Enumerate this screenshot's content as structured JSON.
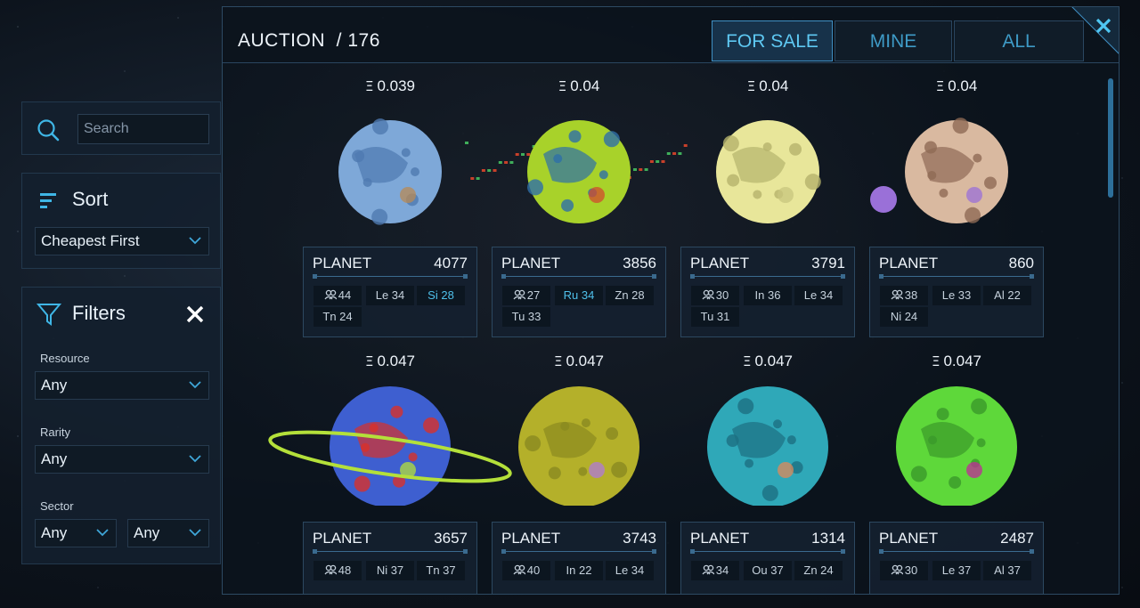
{
  "search": {
    "placeholder": "Search"
  },
  "sort": {
    "title": "Sort",
    "value": "Cheapest First"
  },
  "filters": {
    "title": "Filters",
    "resource_label": "Resource",
    "resource_value": "Any",
    "rarity_label": "Rarity",
    "rarity_value": "Any",
    "sector_label": "Sector",
    "sector_value_1": "Any",
    "sector_value_2": "Any"
  },
  "header": {
    "title": "AUCTION  / 176"
  },
  "tabs": [
    {
      "label": "FOR SALE",
      "active": true
    },
    {
      "label": "MINE",
      "active": false
    },
    {
      "label": "ALL",
      "active": false
    }
  ],
  "items": [
    {
      "price": "0.039",
      "type": "PLANET",
      "id": "4077",
      "chips": [
        {
          "t": "44",
          "pop": true
        },
        {
          "t": "Le 34"
        },
        {
          "t": "Si 28",
          "hl": true
        },
        {
          "t": "Tn 24"
        }
      ],
      "colors": {
        "body": "#7ea8d8",
        "shade": "#4f79b0",
        "accent": "#b88a55"
      }
    },
    {
      "price": "0.04",
      "type": "PLANET",
      "id": "3856",
      "chips": [
        {
          "t": "27",
          "pop": true
        },
        {
          "t": "Ru 34",
          "hl": true
        },
        {
          "t": "Zn 28"
        },
        {
          "t": "Tu 33"
        }
      ],
      "colors": {
        "body": "#a8d22a",
        "shade": "#2e6fa8",
        "accent": "#d24a2e"
      }
    },
    {
      "price": "0.04",
      "type": "PLANET",
      "id": "3791",
      "chips": [
        {
          "t": "30",
          "pop": true
        },
        {
          "t": "In 36"
        },
        {
          "t": "Le 34"
        },
        {
          "t": "Tu 31"
        }
      ],
      "colors": {
        "body": "#e8e69a",
        "shade": "#b5b36c",
        "accent": "#c8c57e"
      }
    },
    {
      "price": "0.04",
      "type": "PLANET",
      "id": "860",
      "chips": [
        {
          "t": "38",
          "pop": true
        },
        {
          "t": "Le 33"
        },
        {
          "t": "Al 22"
        },
        {
          "t": "Ni 24"
        }
      ],
      "colors": {
        "body": "#d9b9a0",
        "shade": "#8f6a55",
        "accent": "#9a70d8"
      }
    },
    {
      "price": "0.047",
      "type": "PLANET",
      "id": "3657",
      "chips": [
        {
          "t": "48",
          "pop": true
        },
        {
          "t": "Ni 37"
        },
        {
          "t": "Tn 37"
        }
      ],
      "colors": {
        "body": "#3e5fd0",
        "shade": "#d8312a",
        "accent": "#b4e03a"
      }
    },
    {
      "price": "0.047",
      "type": "PLANET",
      "id": "3743",
      "chips": [
        {
          "t": "40",
          "pop": true
        },
        {
          "t": "In 22"
        },
        {
          "t": "Le 34"
        }
      ],
      "colors": {
        "body": "#b4b02a",
        "shade": "#8a8a20",
        "accent": "#b07ad8"
      }
    },
    {
      "price": "0.047",
      "type": "PLANET",
      "id": "1314",
      "chips": [
        {
          "t": "34",
          "pop": true
        },
        {
          "t": "Ou 37"
        },
        {
          "t": "Zn 24"
        }
      ],
      "colors": {
        "body": "#2fa8b8",
        "shade": "#1d6f82",
        "accent": "#e08a5a"
      }
    },
    {
      "price": "0.047",
      "type": "PLANET",
      "id": "2487",
      "chips": [
        {
          "t": "30",
          "pop": true
        },
        {
          "t": "Le 37"
        },
        {
          "t": "Al 37"
        }
      ],
      "colors": {
        "body": "#5ed83a",
        "shade": "#3a9a2a",
        "accent": "#c02a9a"
      }
    }
  ]
}
